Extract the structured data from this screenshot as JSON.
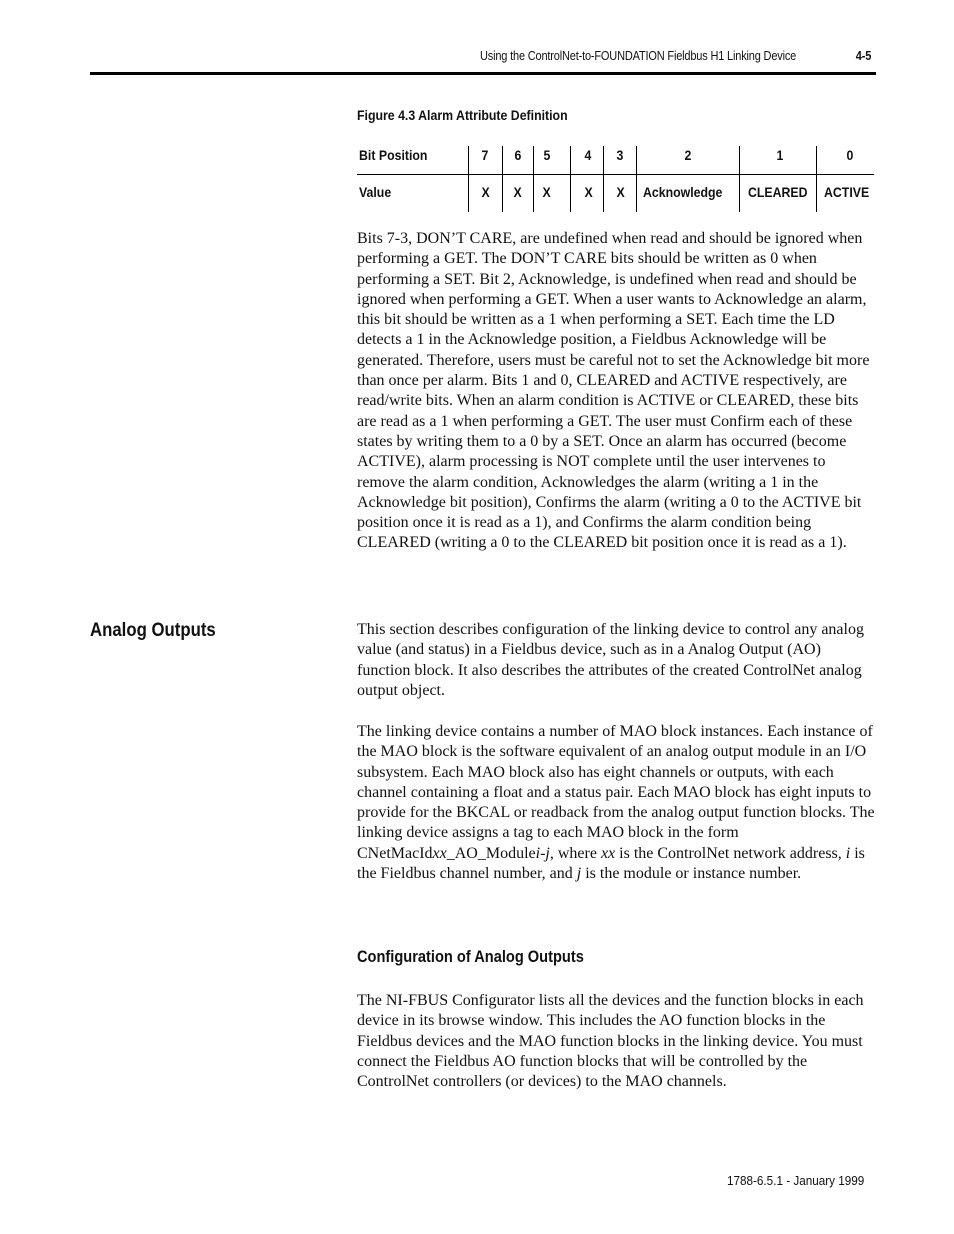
{
  "header": {
    "title": "Using the ControlNet-to-FOUNDATION Fieldbus H1 Linking Device",
    "page_number": "4-5"
  },
  "figure": {
    "caption": "Figure 4.3 Alarm Attribute Definition",
    "table": {
      "row_labels": [
        "Bit Position",
        "Value"
      ],
      "bit_positions": [
        "7",
        "6",
        "5",
        "4",
        "3",
        "2",
        "1",
        "0"
      ],
      "values": [
        "X",
        "X",
        "X",
        "X",
        "X",
        "Acknowledge",
        "CLEARED",
        "ACTIVE"
      ]
    }
  },
  "alarm_paragraph": "Bits 7-3, DON’T CARE, are undefined when read and should be ignored when performing a GET. The DON’T CARE bits should be written as 0 when performing a SET. Bit 2, Acknowledge, is undefined when read and should be ignored when performing a GET. When a user wants to Acknowledge an alarm, this bit should be written as a 1 when performing a SET. Each time the LD detects a 1 in the Acknowledge position, a Fieldbus Acknowledge will be generated. Therefore, users must be careful not to set the Acknowledge bit more than once per alarm. Bits 1 and 0, CLEARED and ACTIVE respectively, are read/write bits. When an alarm condition is ACTIVE or CLEARED, these bits are read as a 1 when performing a GET. The user must Confirm each of these states by writing them to a 0 by a SET. Once an alarm has occurred (become ACTIVE), alarm processing is NOT complete until the user intervenes to remove the alarm condition, Acknowledges the alarm (writing a 1 in the Acknowledge bit position), Confirms the alarm (writing a 0 to the ACTIVE bit position once it is read as a 1), and Confirms the alarm condition being CLEARED (writing a 0 to the CLEARED bit position once it is read as a 1).",
  "analog_outputs": {
    "heading": "Analog Outputs",
    "intro": "This section describes configuration of the linking device to control any analog value (and status) in a Fieldbus device, such as in a Analog Output (AO) function block. It also describes the attributes of the created ControlNet analog output object.",
    "mao_paragraph": {
      "part1": "The linking device contains a number of MAO block instances. Each instance of the MAO block is the software equivalent of an analog output module in an I/O subsystem. Each MAO block also has eight channels or outputs, with each channel containing a float and a status pair. Each MAO block has eight inputs to provide for the BKCAL or readback from the analog output function blocks. The linking device assigns a tag to each MAO block in the form CNetMacId",
      "xx": "xx",
      "part2": "_AO_Module",
      "ij": "i-j",
      "part3": ", where ",
      "xx2": "xx",
      "part4": " is the ControlNet network address, ",
      "i": "i",
      "part5": " is the Fieldbus channel number, and ",
      "j": "j",
      "part6": " is the module or instance number."
    }
  },
  "configuration": {
    "heading": "Configuration of Analog Outputs",
    "paragraph": "The NI-FBUS Configurator lists all the devices and the function blocks in each device in its browse window. This includes the AO function blocks in the Fieldbus devices and the MAO function blocks in the linking device. You must connect the Fieldbus AO function blocks that will be controlled by the ControlNet controllers (or devices) to the MAO channels."
  },
  "footer": {
    "publication": "1788-6.5.1 - January 1999"
  }
}
